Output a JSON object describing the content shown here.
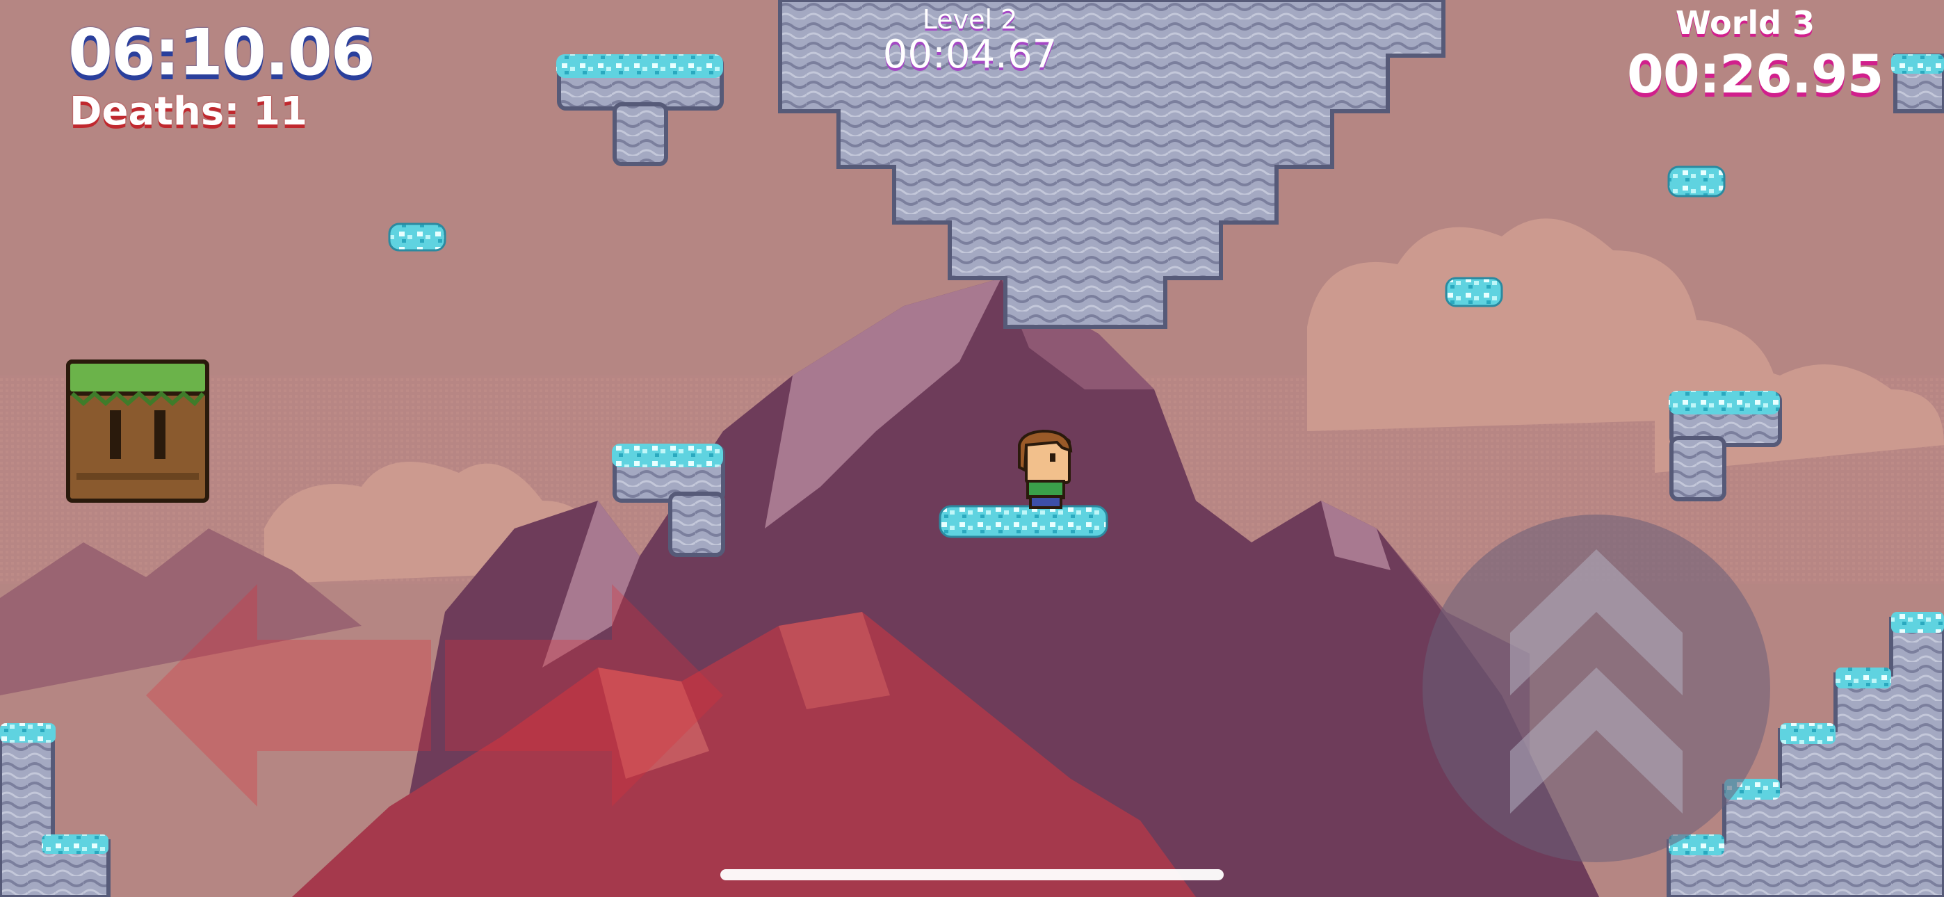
{
  "hud": {
    "total_time": "06:10.06",
    "deaths": "Deaths: 11",
    "level_label": "Level 2",
    "level_time": "00:04.67",
    "world_label": "World 3",
    "world_time": "00:26.95"
  },
  "controls": {
    "move_left": "left-arrow-icon",
    "move_right": "right-arrow-icon",
    "jump": "jump-chevron-icon"
  },
  "colors": {
    "sky": "#b58683",
    "hud_total_shadow": "#2a3f9c",
    "hud_deaths_shadow": "#c0282e",
    "hud_level_shadow": "#a548c5",
    "hud_world_shadow": "#d11f8c",
    "ice": "#7fe3ec",
    "stone": "#9ea3bd",
    "mountain_dark": "#6b3a55",
    "mountain_red": "#a63c4c"
  }
}
